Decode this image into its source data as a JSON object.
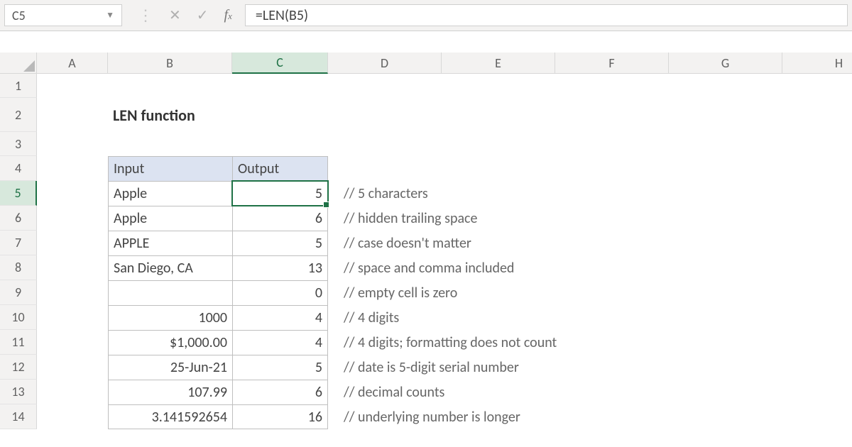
{
  "name_box": "C5",
  "formula": "=LEN(B5)",
  "columns": [
    "A",
    "B",
    "C",
    "D",
    "E",
    "F",
    "G",
    "H"
  ],
  "row_numbers": [
    "1",
    "2",
    "3",
    "4",
    "5",
    "6",
    "7",
    "8",
    "9",
    "10",
    "11",
    "12",
    "13",
    "14"
  ],
  "title": "LEN function",
  "headers": {
    "input": "Input",
    "output": "Output"
  },
  "rows": [
    {
      "input": "Apple",
      "output": "5",
      "comment": "// 5 characters",
      "align": "left"
    },
    {
      "input": "Apple",
      "output": "6",
      "comment": "// hidden trailing space",
      "align": "left"
    },
    {
      "input": "APPLE",
      "output": "5",
      "comment": "// case doesn't matter",
      "align": "left"
    },
    {
      "input": "San Diego, CA",
      "output": "13",
      "comment": "// space and comma included",
      "align": "left"
    },
    {
      "input": "",
      "output": "0",
      "comment": "// empty cell is zero",
      "align": "left"
    },
    {
      "input": "1000",
      "output": "4",
      "comment": "// 4 digits",
      "align": "right"
    },
    {
      "input": "$1,000.00",
      "output": "4",
      "comment": "// 4 digits; formatting does not count",
      "align": "right"
    },
    {
      "input": "25-Jun-21",
      "output": "5",
      "comment": "// date is 5-digit serial number",
      "align": "right"
    },
    {
      "input": "107.99",
      "output": "6",
      "comment": "// decimal counts",
      "align": "right"
    },
    {
      "input": "3.141592654",
      "output": "16",
      "comment": "// underlying number is longer",
      "align": "right"
    }
  ],
  "chart_data": {
    "type": "table",
    "title": "LEN function",
    "columns": [
      "Input",
      "Output",
      "Comment"
    ],
    "rows": [
      [
        "Apple",
        "5",
        "5 characters"
      ],
      [
        "Apple",
        "6",
        "hidden trailing space"
      ],
      [
        "APPLE",
        "5",
        "case doesn't matter"
      ],
      [
        "San Diego, CA",
        "13",
        "space and comma included"
      ],
      [
        "",
        "0",
        "empty cell is zero"
      ],
      [
        "1000",
        "4",
        "4 digits"
      ],
      [
        "$1,000.00",
        "4",
        "4 digits; formatting does not count"
      ],
      [
        "25-Jun-21",
        "5",
        "date is 5-digit serial number"
      ],
      [
        "107.99",
        "6",
        "decimal counts"
      ],
      [
        "3.141592654",
        "16",
        "underlying number is longer"
      ]
    ]
  }
}
